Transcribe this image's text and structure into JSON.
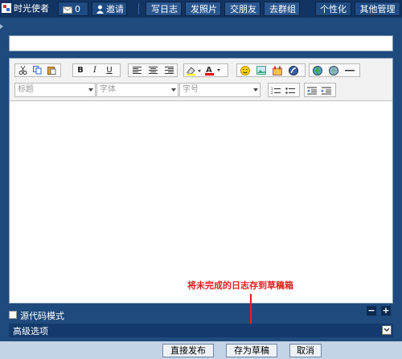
{
  "topbar": {
    "user": "时光使者",
    "messages_count": "0",
    "invite": "邀请",
    "tabs": [
      "写日志",
      "发照片",
      "交朋友",
      "去群组"
    ],
    "personalize": "个性化",
    "manage": "其他管理"
  },
  "editor": {
    "title_value": "",
    "heading_select": "标题",
    "font_select": "字体",
    "size_select": "字号",
    "body": ""
  },
  "annotation": {
    "text": "将未完成的日志存到草稿箱",
    "color": "#e02020"
  },
  "options": {
    "source_mode_label": "源代码模式",
    "source_mode_checked": false,
    "advanced_label": "高级选项",
    "minus": "−",
    "plus": "+"
  },
  "footer": {
    "publish": "直接发布",
    "save_draft": "存为草稿",
    "cancel": "取消"
  }
}
